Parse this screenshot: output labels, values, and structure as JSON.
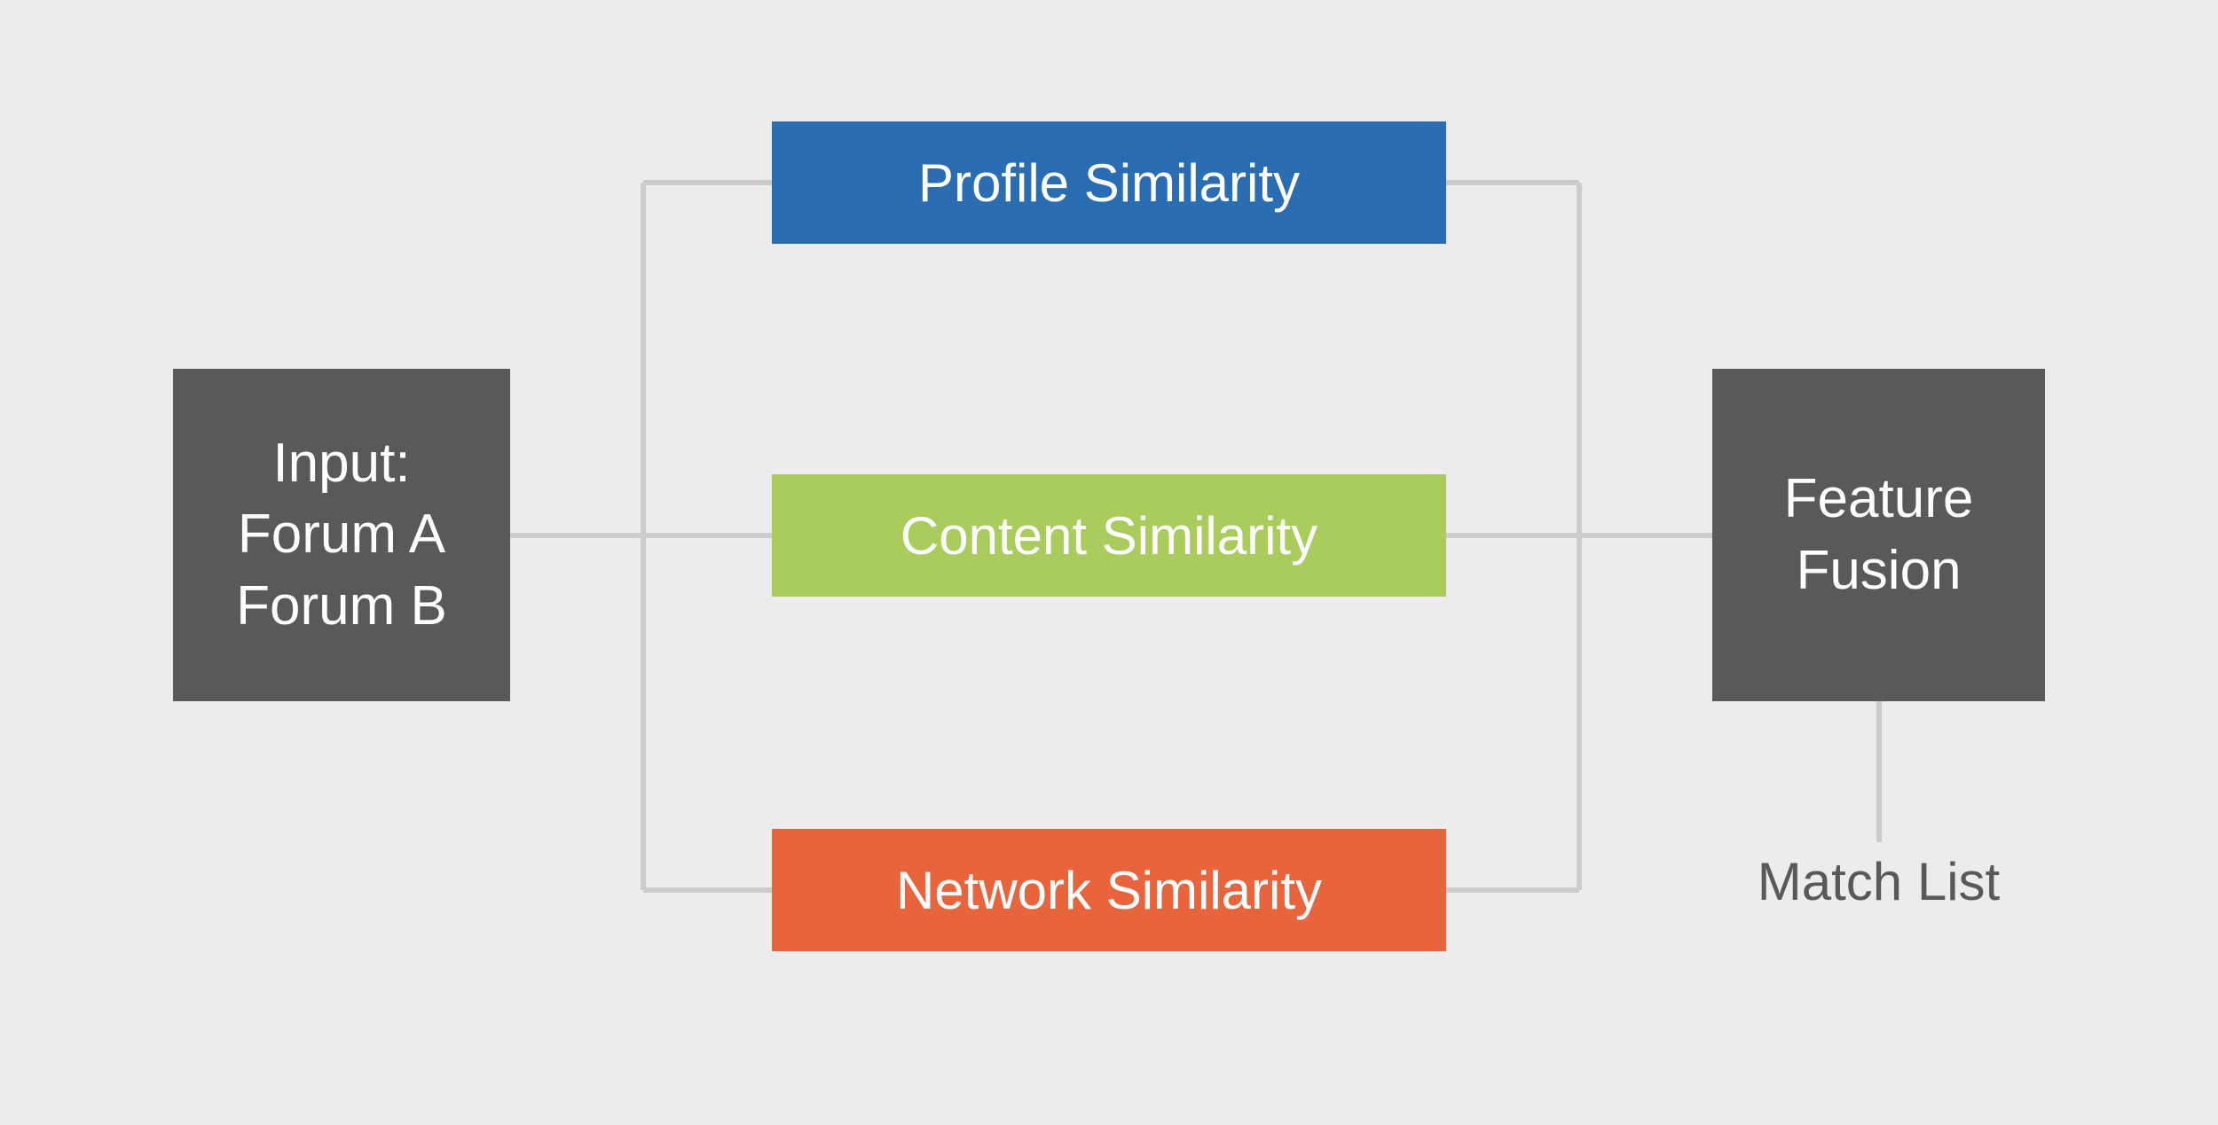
{
  "diagram": {
    "input": {
      "line1": "Input:",
      "line2": "Forum A",
      "line3": "Forum B"
    },
    "profile": "Profile Similarity",
    "content": "Content Similarity",
    "network": "Network Similarity",
    "fusion": {
      "line1": "Feature",
      "line2": "Fusion"
    },
    "output_label": "Match List"
  }
}
